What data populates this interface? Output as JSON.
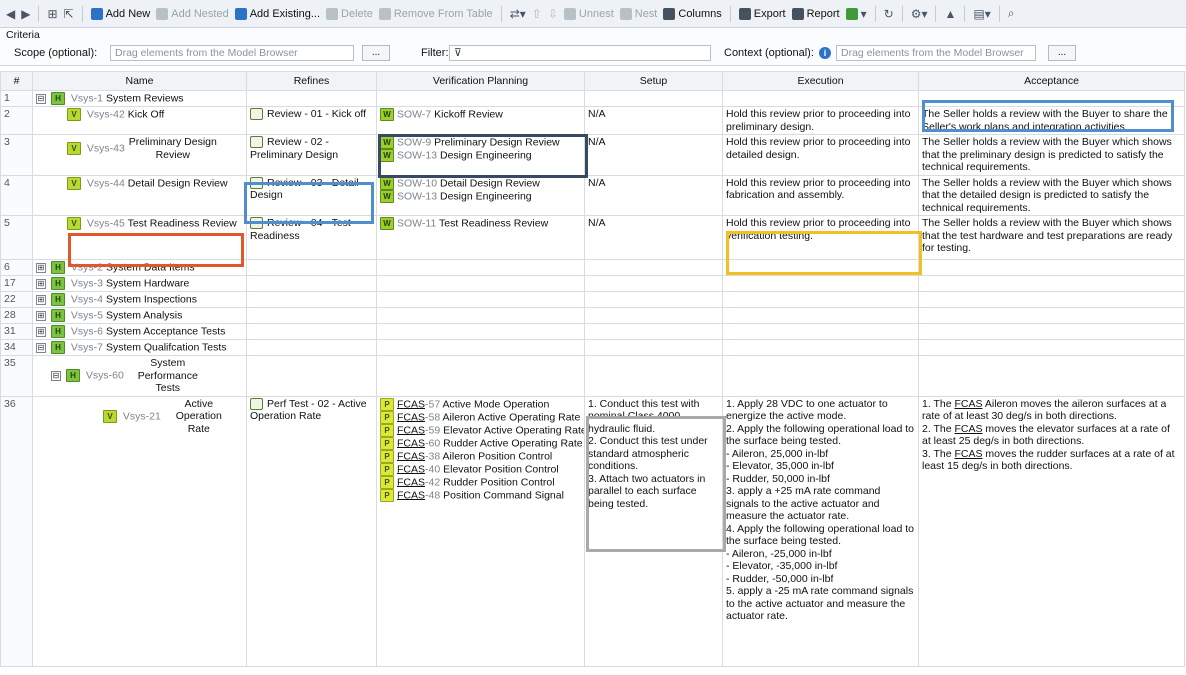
{
  "toolbar": {
    "add_new": "Add New",
    "add_nested": "Add Nested",
    "add_existing": "Add Existing...",
    "delete": "Delete",
    "remove_from_table": "Remove From Table",
    "unnest": "Unnest",
    "nest": "Nest",
    "columns": "Columns",
    "export": "Export",
    "report": "Report"
  },
  "criteria": {
    "title": "Criteria",
    "scope_label": "Scope (optional):",
    "scope_placeholder": "Drag elements from the Model Browser",
    "browse_label": "...",
    "filter_label": "Filter:",
    "context_label": "Context (optional):",
    "context_placeholder": "Drag elements from the Model Browser",
    "context_browse_label": "..."
  },
  "columns": {
    "num": "#",
    "name": "Name",
    "refines": "Refines",
    "verification": "Verification Planning",
    "setup": "Setup",
    "execution": "Execution",
    "acceptance": "Acceptance"
  },
  "rows": [
    {
      "num": "1",
      "toggle": "⊟",
      "badge": "H",
      "id": "Vsys-1",
      "name": "System Reviews"
    },
    {
      "num": "2",
      "badge": "V",
      "id": "Vsys-42",
      "name": "Kick Off",
      "refines": "Review - 01 - Kick off",
      "vp": [
        {
          "id": "SOW-7",
          "name": "Kickoff Review"
        }
      ],
      "setup": "N/A",
      "execution": "Hold this review prior to proceeding into preliminary design.",
      "acceptance": "The Seller holds a  review with the Buyer to share the Seller's work plans and integration activities."
    },
    {
      "num": "3",
      "badge": "V",
      "id": "Vsys-43",
      "name": "Preliminary Design Review",
      "refines": "Review - 02 - Preliminary Design",
      "vp": [
        {
          "id": "SOW-9",
          "name": "Preliminary Design Review"
        },
        {
          "id": "SOW-13",
          "name": "Design Engineering"
        }
      ],
      "setup": "N/A",
      "execution": "Hold this review prior to proceeding into detailed design.",
      "acceptance": "The Seller holds a review with the Buyer which shows that the preliminary design is predicted to satisfy the technical requirements."
    },
    {
      "num": "4",
      "badge": "V",
      "id": "Vsys-44",
      "name": "Detail Design Review",
      "refines": "Review - 03 - Detail Design",
      "vp": [
        {
          "id": "SOW-10",
          "name": "Detail Design Review"
        },
        {
          "id": "SOW-13",
          "name": "Design Engineering"
        }
      ],
      "setup": "N/A",
      "execution": "Hold this review prior to proceeding into fabrication and assembly.",
      "acceptance": "The Seller holds a review with the Buyer which shows that the detailed design is predicted to satisfy the technical requirements."
    },
    {
      "num": "5",
      "badge": "V",
      "id": "Vsys-45",
      "name": "Test Readiness Review",
      "refines": "Review - 04 - Test Readiness",
      "vp": [
        {
          "id": "SOW-11",
          "name": "Test Readiness Review"
        }
      ],
      "setup": "N/A",
      "execution": "Hold this review prior to proceeding into verification testing.",
      "acceptance": "The Seller holds a review with the Buyer which shows that the test hardware and test preparations are ready for testing."
    },
    {
      "num": "6",
      "toggle": "⊞",
      "badge": "H",
      "id": "Vsys-2",
      "name": "System Data Items"
    },
    {
      "num": "17",
      "toggle": "⊞",
      "badge": "H",
      "id": "Vsys-3",
      "name": "System Hardware"
    },
    {
      "num": "22",
      "toggle": "⊞",
      "badge": "H",
      "id": "Vsys-4",
      "name": "System Inspections"
    },
    {
      "num": "28",
      "toggle": "⊞",
      "badge": "H",
      "id": "Vsys-5",
      "name": "System Analysis"
    },
    {
      "num": "31",
      "toggle": "⊞",
      "badge": "H",
      "id": "Vsys-6",
      "name": "System Acceptance Tests"
    },
    {
      "num": "34",
      "toggle": "⊟",
      "badge": "H",
      "id": "Vsys-7",
      "name": "System Qualifcation Tests"
    },
    {
      "num": "35",
      "toggle": "⊟",
      "badge": "H",
      "id": "Vsys-60",
      "name": "System Performance Tests"
    },
    {
      "num": "36",
      "badge": "V",
      "id": "Vsys-21",
      "name": "Active Operation Rate",
      "refines": "Perf Test - 02 - Active Operation Rate",
      "vp": [
        {
          "badge": "P",
          "id_prefix": "FCAS",
          "id": "-57",
          "name": "Active Mode Operation"
        },
        {
          "badge": "P",
          "id_prefix": "FCAS",
          "id": "-58",
          "name": "Aileron Active Operating Rate"
        },
        {
          "badge": "P",
          "id_prefix": "FCAS",
          "id": "-59",
          "name": "Elevator Active Operating Rate"
        },
        {
          "badge": "P",
          "id_prefix": "FCAS",
          "id": "-60",
          "name": "Rudder Active Operating Rate"
        },
        {
          "badge": "P",
          "id_prefix": "FCAS",
          "id": "-38",
          "name": "Aileron Position Control"
        },
        {
          "badge": "P",
          "id_prefix": "FCAS",
          "id": "-40",
          "name": "Elevator Position Control"
        },
        {
          "badge": "P",
          "id_prefix": "FCAS",
          "id": "-42",
          "name": "Rudder Position Control"
        },
        {
          "badge": "P",
          "id_prefix": "FCAS",
          "id": "-48",
          "name": "Position Command Signal"
        }
      ],
      "setup": "1. Conduct this test with nominal Class 4000 hydraulic fluid.\n2. Conduct this test under standard atmospheric conditions.\n3. Attach two actuators in parallel to each surface being tested.",
      "execution": "1.  Apply 28 VDC to one actuator to energize the active mode.\n2.  Apply the following operational load to the surface being tested.\n  - Aileron, 25,000 in-lbf\n  - Elevator, 35,000 in-lbf\n  - Rudder, 50,000 in-lbf\n3. apply a +25 mA rate command signals to the active actuator and measure the actuator rate.\n4.  Apply the following operational load to the surface being tested.\n  - Aileron, -25,000 in-lbf\n  - Elevator, -35,000 in-lbf\n  - Rudder, -50,000 in-lbf\n5. apply a -25 mA rate command signals to the active actuator and measure the actuator rate.",
      "acceptance_parts": [
        {
          "pre": "1. The ",
          "link": "FCAS",
          "post": " Aileron moves the aileron surfaces at a rate of at least 30 deg/s in both directions."
        },
        {
          "pre": "2. The ",
          "link": "FCAS",
          "post": " moves the elevator surfaces at a rate of at least 25 deg/s in both directions."
        },
        {
          "pre": "3. The ",
          "link": "FCAS",
          "post": " moves the rudder surfaces at a rate of at least 15 deg/s in both directions."
        }
      ]
    }
  ]
}
